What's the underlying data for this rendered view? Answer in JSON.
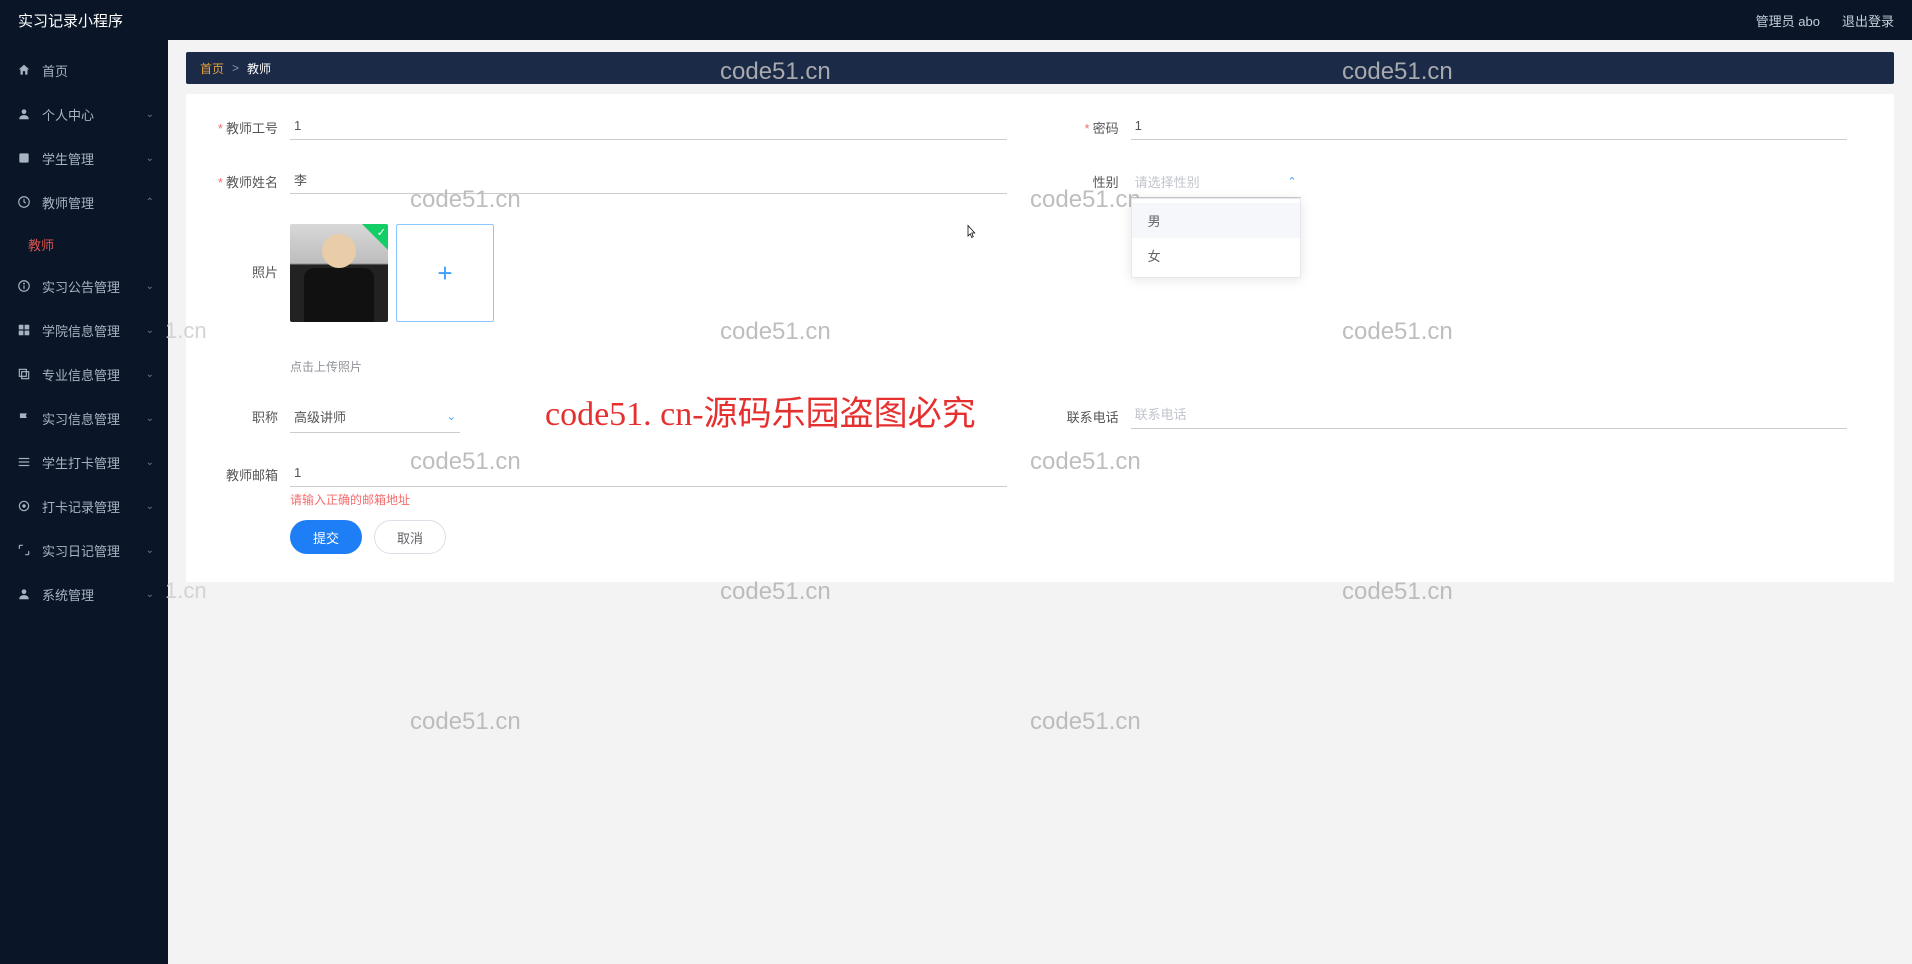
{
  "app": {
    "title": "实习记录小程序"
  },
  "topbar": {
    "user_label": "管理员 abo",
    "logout": "退出登录"
  },
  "sidebar": {
    "items": [
      {
        "label": "首页",
        "icon": "home"
      },
      {
        "label": "个人中心",
        "icon": "user",
        "chev": "down"
      },
      {
        "label": "学生管理",
        "icon": "folder",
        "chev": "down"
      },
      {
        "label": "教师管理",
        "icon": "clock",
        "chev": "up",
        "expanded": true
      },
      {
        "label": "实习公告管理",
        "icon": "info",
        "chev": "down"
      },
      {
        "label": "学院信息管理",
        "icon": "grid",
        "chev": "down"
      },
      {
        "label": "专业信息管理",
        "icon": "copy",
        "chev": "down"
      },
      {
        "label": "实习信息管理",
        "icon": "flag",
        "chev": "down"
      },
      {
        "label": "学生打卡管理",
        "icon": "list",
        "chev": "down"
      },
      {
        "label": "打卡记录管理",
        "icon": "target",
        "chev": "down"
      },
      {
        "label": "实习日记管理",
        "icon": "expand",
        "chev": "down"
      },
      {
        "label": "系统管理",
        "icon": "user",
        "chev": "down"
      }
    ],
    "active_sub": "教师"
  },
  "breadcrumb": {
    "home": "首页",
    "sep": ">",
    "current": "教师"
  },
  "form": {
    "teacher_id": {
      "label": "教师工号",
      "value": "1",
      "required": true
    },
    "password": {
      "label": "密码",
      "value": "1",
      "required": true
    },
    "teacher_name": {
      "label": "教师姓名",
      "value": "李",
      "required": true
    },
    "gender": {
      "label": "性别",
      "placeholder": "请选择性别",
      "options": [
        "男",
        "女"
      ]
    },
    "photo": {
      "label": "照片",
      "hint": "点击上传照片"
    },
    "title": {
      "label": "职称",
      "value": "高级讲师"
    },
    "phone": {
      "label": "联系电话",
      "placeholder": "联系电话"
    },
    "email": {
      "label": "教师邮箱",
      "value": "1",
      "error": "请输入正确的邮箱地址"
    },
    "submit": "提交",
    "cancel": "取消"
  },
  "watermarks": {
    "grey": "code51.cn",
    "red": "code51. cn-源码乐园盗图必究"
  }
}
